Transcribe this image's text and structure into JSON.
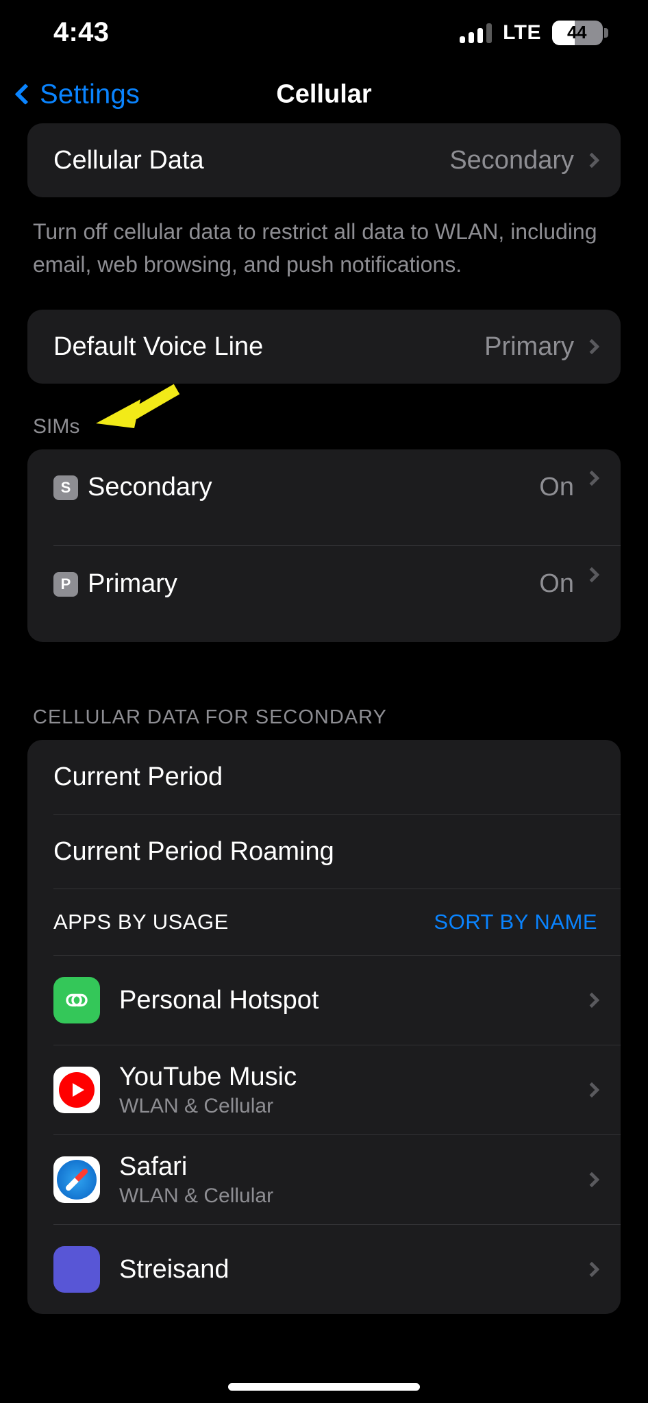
{
  "status_bar": {
    "time": "4:43",
    "network": "LTE",
    "battery_level": "44",
    "battery_percent": 44,
    "signal_bars": 4,
    "signal_bars_active": 3
  },
  "nav": {
    "back_label": "Settings",
    "title": "Cellular"
  },
  "cellular_data": {
    "label": "Cellular Data",
    "value": "Secondary",
    "footer": "Turn off cellular data to restrict all data to WLAN, including email, web browsing, and push notifications."
  },
  "default_voice": {
    "label": "Default Voice Line",
    "value": "Primary"
  },
  "sims": {
    "header": "SIMs",
    "items": [
      {
        "badge": "S",
        "label": "Secondary",
        "value": "On"
      },
      {
        "badge": "P",
        "label": "Primary",
        "value": "On"
      }
    ]
  },
  "data_section": {
    "header": "CELLULAR DATA FOR SECONDARY",
    "rows": [
      {
        "label": "Current Period"
      },
      {
        "label": "Current Period Roaming"
      }
    ],
    "usage_header": {
      "left": "APPS BY USAGE",
      "right": "SORT BY NAME"
    },
    "apps": [
      {
        "name": "Personal Hotspot",
        "sub": "",
        "icon": "hotspot-icon"
      },
      {
        "name": "YouTube Music",
        "sub": "WLAN & Cellular",
        "icon": "youtube-music-icon"
      },
      {
        "name": "Safari",
        "sub": "WLAN & Cellular",
        "icon": "safari-icon"
      },
      {
        "name": "Streisand",
        "sub": "",
        "icon": "streisand-icon"
      }
    ]
  },
  "annotation": {
    "type": "arrow",
    "color": "#f2ea18",
    "points_to": "SIMs"
  },
  "colors": {
    "background": "#000000",
    "group_background": "#1c1c1e",
    "accent_blue": "#0a84ff",
    "secondary_text": "#8e8e93",
    "hotspot_green": "#34c759",
    "annotation_yellow": "#f2ea18"
  }
}
